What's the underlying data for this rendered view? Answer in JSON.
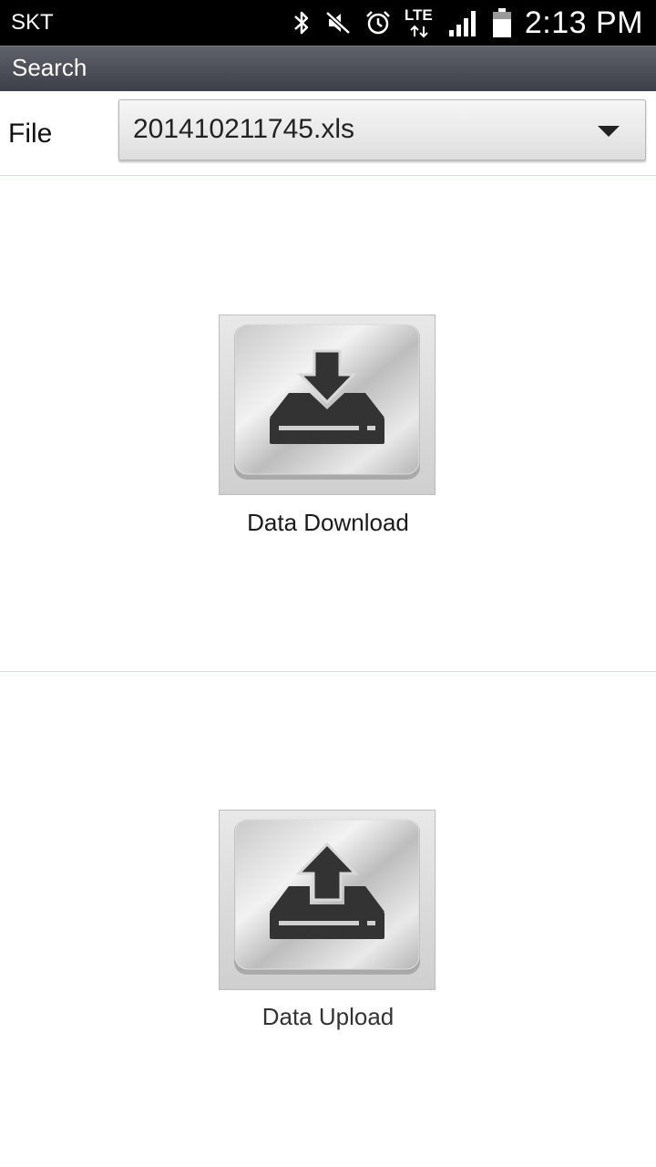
{
  "status_bar": {
    "carrier": "SKT",
    "network": "LTE",
    "time": "2:13 PM",
    "icons": [
      "bluetooth-icon",
      "mute-icon",
      "alarm-icon",
      "lte-icon",
      "signal-icon",
      "battery-icon"
    ]
  },
  "title_bar": {
    "title": "Search"
  },
  "file_row": {
    "label": "File",
    "selected_value": "201410211745.xls"
  },
  "actions": {
    "download_label": "Data Download",
    "upload_label": "Data Upload"
  },
  "colors": {
    "status_bg": "#000000",
    "title_bar_bg": "#4b4e56",
    "divider": "#d9dde4",
    "icon_dark": "#333333"
  }
}
